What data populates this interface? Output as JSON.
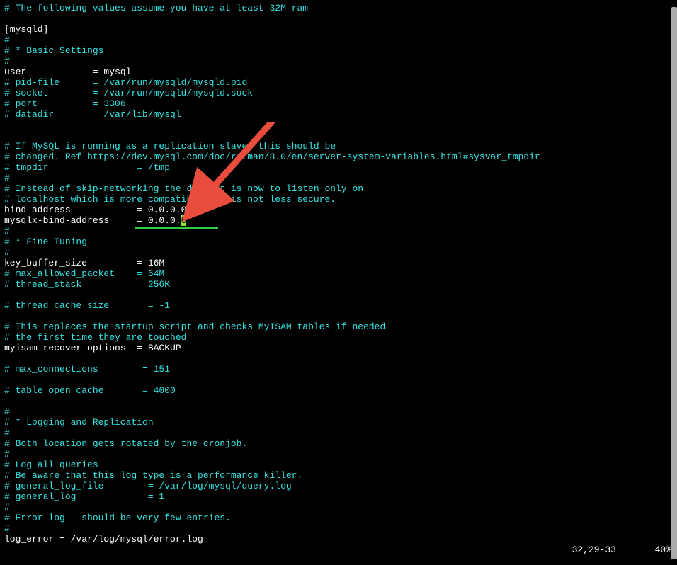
{
  "lines": [
    {
      "cls": "comment",
      "text": "# The following values assume you have at least 32M ram"
    },
    {
      "cls": "param",
      "text": ""
    },
    {
      "cls": "param",
      "text": "[mysqld]"
    },
    {
      "cls": "comment",
      "text": "#"
    },
    {
      "cls": "comment",
      "text": "# * Basic Settings"
    },
    {
      "cls": "comment",
      "text": "#"
    },
    {
      "cls": "param",
      "text": "user            = mysql"
    },
    {
      "cls": "comment",
      "text": "# pid-file      = /var/run/mysqld/mysqld.pid"
    },
    {
      "cls": "comment",
      "text": "# socket        = /var/run/mysqld/mysqld.sock"
    },
    {
      "cls": "comment",
      "text": "# port          = 3306"
    },
    {
      "cls": "comment",
      "text": "# datadir       = /var/lib/mysql"
    },
    {
      "cls": "param",
      "text": ""
    },
    {
      "cls": "param",
      "text": ""
    },
    {
      "cls": "comment",
      "text": "# If MySQL is running as a replication slave, this should be"
    },
    {
      "cls": "comment",
      "text": "# changed. Ref https://dev.mysql.com/doc/refman/8.0/en/server-system-variables.html#sysvar_tmpdir"
    },
    {
      "cls": "comment",
      "text": "# tmpdir                = /tmp"
    },
    {
      "cls": "comment",
      "text": "#"
    },
    {
      "cls": "comment",
      "text": "# Instead of skip-networking the default is now to listen only on"
    },
    {
      "cls": "comment",
      "text": "# localhost which is more compatible and is not less secure."
    },
    {
      "cls": "param",
      "text": "bind-address            = 0.0.0.0"
    },
    {
      "cls": "param",
      "text": "mysqlx-bind-address     = 0.0.0.",
      "cursor": "0"
    },
    {
      "cls": "comment",
      "text": "#"
    },
    {
      "cls": "comment",
      "text": "# * Fine Tuning"
    },
    {
      "cls": "comment",
      "text": "#"
    },
    {
      "cls": "param",
      "text": "key_buffer_size         = 16M"
    },
    {
      "cls": "comment",
      "text": "# max_allowed_packet    = 64M"
    },
    {
      "cls": "comment",
      "text": "# thread_stack          = 256K"
    },
    {
      "cls": "param",
      "text": ""
    },
    {
      "cls": "comment",
      "text": "# thread_cache_size       = -1"
    },
    {
      "cls": "param",
      "text": ""
    },
    {
      "cls": "comment",
      "text": "# This replaces the startup script and checks MyISAM tables if needed"
    },
    {
      "cls": "comment",
      "text": "# the first time they are touched"
    },
    {
      "cls": "param",
      "text": "myisam-recover-options  = BACKUP"
    },
    {
      "cls": "param",
      "text": ""
    },
    {
      "cls": "comment",
      "text": "# max_connections        = 151"
    },
    {
      "cls": "param",
      "text": ""
    },
    {
      "cls": "comment",
      "text": "# table_open_cache       = 4000"
    },
    {
      "cls": "param",
      "text": ""
    },
    {
      "cls": "comment",
      "text": "#"
    },
    {
      "cls": "comment",
      "text": "# * Logging and Replication"
    },
    {
      "cls": "comment",
      "text": "#"
    },
    {
      "cls": "comment",
      "text": "# Both location gets rotated by the cronjob."
    },
    {
      "cls": "comment",
      "text": "#"
    },
    {
      "cls": "comment",
      "text": "# Log all queries"
    },
    {
      "cls": "comment",
      "text": "# Be aware that this log type is a performance killer."
    },
    {
      "cls": "comment",
      "text": "# general_log_file        = /var/log/mysql/query.log"
    },
    {
      "cls": "comment",
      "text": "# general_log             = 1"
    },
    {
      "cls": "comment",
      "text": "#"
    },
    {
      "cls": "comment",
      "text": "# Error log - should be very few entries."
    },
    {
      "cls": "comment",
      "text": "#"
    },
    {
      "cls": "param",
      "text": "log_error = /var/log/mysql/error.log"
    }
  ],
  "status": {
    "position": "32,29-33",
    "percent": "40%"
  }
}
